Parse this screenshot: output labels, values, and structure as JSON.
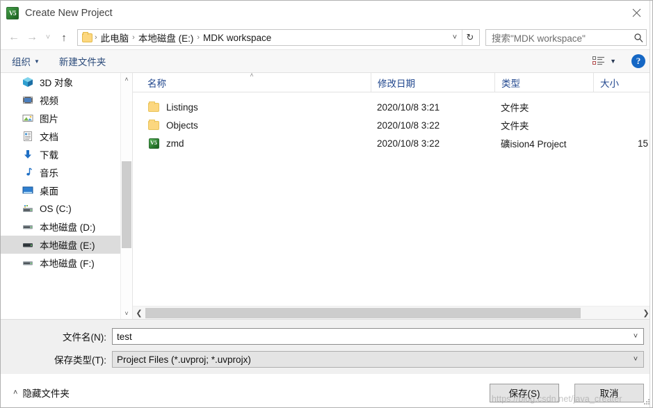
{
  "window": {
    "title": "Create New Project",
    "app_icon": "uvision-icon",
    "close_label": "✕"
  },
  "nav": {
    "back_icon": "arrow-left-icon",
    "forward_icon": "arrow-right-icon",
    "history_icon": "chevron-down-icon",
    "up_icon": "arrow-up-icon",
    "refresh_icon": "refresh-icon",
    "address_chevron": "chevron-down-icon",
    "breadcrumbs": [
      {
        "label": "此电脑"
      },
      {
        "label": "本地磁盘 (E:)"
      },
      {
        "label": "MDK workspace"
      }
    ],
    "separator": "›"
  },
  "search": {
    "placeholder": "搜索\"MDK workspace\"",
    "icon": "search-icon"
  },
  "toolbar": {
    "organize_label": "组织",
    "new_folder_label": "新建文件夹",
    "view_icon": "list-view-icon",
    "view_caret": "▼",
    "help_label": "?"
  },
  "sidebar": {
    "items": [
      {
        "label": "3D 对象",
        "icon": "3d-objects-icon",
        "selected": false
      },
      {
        "label": "视频",
        "icon": "videos-icon",
        "selected": false
      },
      {
        "label": "图片",
        "icon": "pictures-icon",
        "selected": false
      },
      {
        "label": "文档",
        "icon": "documents-icon",
        "selected": false
      },
      {
        "label": "下载",
        "icon": "downloads-icon",
        "selected": false
      },
      {
        "label": "音乐",
        "icon": "music-icon",
        "selected": false
      },
      {
        "label": "桌面",
        "icon": "desktop-icon",
        "selected": false
      },
      {
        "label": "OS (C:)",
        "icon": "system-drive-icon",
        "selected": false
      },
      {
        "label": "本地磁盘 (D:)",
        "icon": "drive-icon",
        "selected": false
      },
      {
        "label": "本地磁盘 (E:)",
        "icon": "drive-icon",
        "selected": true
      },
      {
        "label": "本地磁盘 (F:)",
        "icon": "drive-icon",
        "selected": false
      }
    ],
    "scroll_up_icon": "chevron-up-icon",
    "scroll_down_icon": "chevron-down-icon"
  },
  "filelist": {
    "columns": [
      {
        "key": "name",
        "label": "名称",
        "sorted": true,
        "sort_caret": "˄"
      },
      {
        "key": "date",
        "label": "修改日期",
        "sorted": false
      },
      {
        "key": "type",
        "label": "类型",
        "sorted": false
      },
      {
        "key": "size",
        "label": "大小",
        "sorted": false
      }
    ],
    "rows": [
      {
        "icon": "folder-icon",
        "name": "Listings",
        "date": "2020/10/8 3:21",
        "type": "文件夹",
        "size": ""
      },
      {
        "icon": "folder-icon",
        "name": "Objects",
        "date": "2020/10/8 3:22",
        "type": "文件夹",
        "size": ""
      },
      {
        "icon": "uvision-project-icon",
        "name": "zmd",
        "date": "2020/10/8 3:22",
        "type": "礦ision4 Project",
        "size": "15"
      }
    ],
    "hscroll_left_icon": "chevron-left-icon",
    "hscroll_right_icon": "chevron-right-icon"
  },
  "form": {
    "filename_label": "文件名(N):",
    "filename_value": "test",
    "filetype_label": "保存类型(T):",
    "filetype_value": "Project Files (*.uvproj; *.uvprojx)",
    "chevron": "˅"
  },
  "footer": {
    "hide_folders_label": "隐藏文件夹",
    "hide_folders_caret": "˄",
    "save_label": "保存(S)",
    "cancel_label": "取消"
  },
  "watermark": {
    "text": "https://blog.csdn.net/java_creater"
  },
  "colors": {
    "accent_blue": "#21478e",
    "link_blue": "#2a4a7a",
    "help_blue": "#1567c4",
    "folder_yellow": "#fcd77f",
    "selection_gray": "#dcdcdc",
    "toolbar_gray": "#f7f7f7",
    "footer_gray": "#f0f0f0"
  }
}
